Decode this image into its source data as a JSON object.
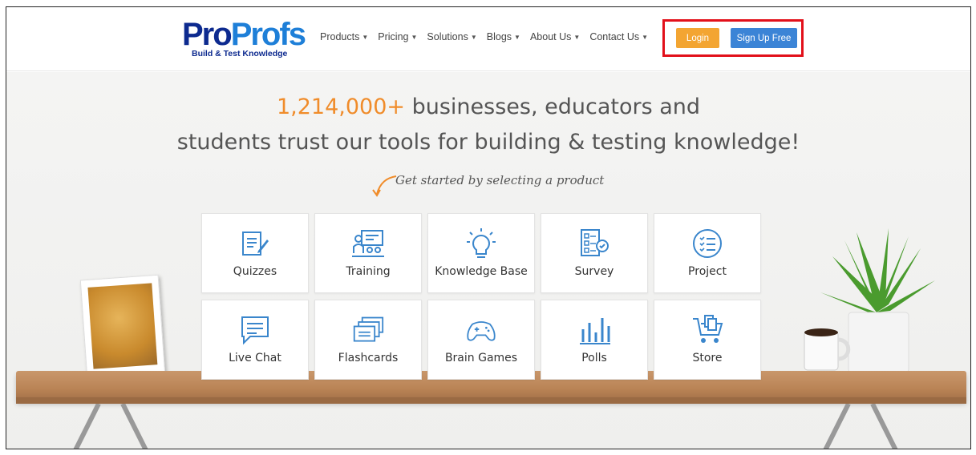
{
  "header": {
    "logo_text_a": "Pro",
    "logo_text_b": "Profs",
    "logo_tagline": "Build & Test Knowledge",
    "nav": [
      {
        "label": "Products"
      },
      {
        "label": "Pricing"
      },
      {
        "label": "Solutions"
      },
      {
        "label": "Blogs"
      },
      {
        "label": "About Us"
      },
      {
        "label": "Contact Us"
      }
    ],
    "login_label": "Login",
    "signup_label": "Sign Up Free"
  },
  "hero": {
    "count": "1,214,000+",
    "headline_rest": " businesses, educators and",
    "headline2": "students trust our tools for building & testing knowledge!",
    "hint": "Get started by selecting a product"
  },
  "products": [
    {
      "label": "Quizzes",
      "icon": "quiz-icon"
    },
    {
      "label": "Training",
      "icon": "training-icon"
    },
    {
      "label": "Knowledge Base",
      "icon": "lightbulb-icon"
    },
    {
      "label": "Survey",
      "icon": "survey-icon"
    },
    {
      "label": "Project",
      "icon": "project-list-icon"
    },
    {
      "label": "Live Chat",
      "icon": "chat-icon"
    },
    {
      "label": "Flashcards",
      "icon": "flashcards-icon"
    },
    {
      "label": "Brain Games",
      "icon": "gamepad-icon"
    },
    {
      "label": "Polls",
      "icon": "bar-chart-icon"
    },
    {
      "label": "Store",
      "icon": "cart-icon"
    }
  ],
  "colors": {
    "accent_orange": "#f08c2a",
    "brand_blue": "#1e7fd8",
    "icon_blue": "#3a86cc",
    "highlight_red": "#e2101a"
  }
}
